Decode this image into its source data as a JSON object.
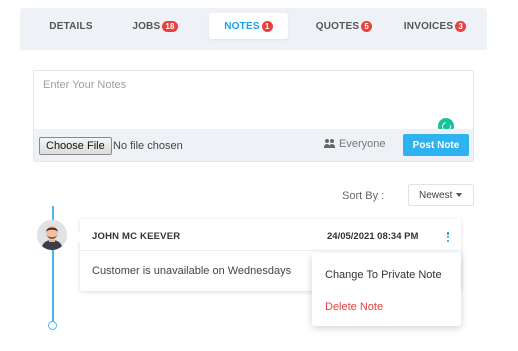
{
  "tabs": [
    {
      "label": "DETAILS",
      "badge": ""
    },
    {
      "label": "JOBS",
      "badge": "18"
    },
    {
      "label": "NOTES",
      "badge": "1"
    },
    {
      "label": "QUOTES",
      "badge": "5"
    },
    {
      "label": "INVOICES",
      "badge": "3"
    }
  ],
  "active_tab": "NOTES",
  "editor": {
    "placeholder": "Enter Your Notes",
    "value": "",
    "choose_file_label": "Choose File",
    "file_status": "No file chosen",
    "visibility_label": "Everyone",
    "post_label": "Post Note"
  },
  "sort": {
    "label": "Sort By :",
    "selected": "Newest"
  },
  "note": {
    "author": "JOHN MC KEEVER",
    "datetime": "24/05/2021 08:34 PM",
    "text": "Customer is unavailable on Wednesdays"
  },
  "menu": {
    "private_label": "Change To Private Note",
    "delete_label": "Delete Note"
  },
  "colors": {
    "accent": "#1aa3e8",
    "post_button": "#2fb3f0",
    "badge": "#e8413c",
    "delete": "#e8413c",
    "panel_bg": "#eef1f5",
    "grammar": "#15c39a"
  },
  "icons": [
    "grammar-check-icon",
    "users-icon",
    "caret-down-icon",
    "kebab-menu-icon",
    "avatar"
  ]
}
